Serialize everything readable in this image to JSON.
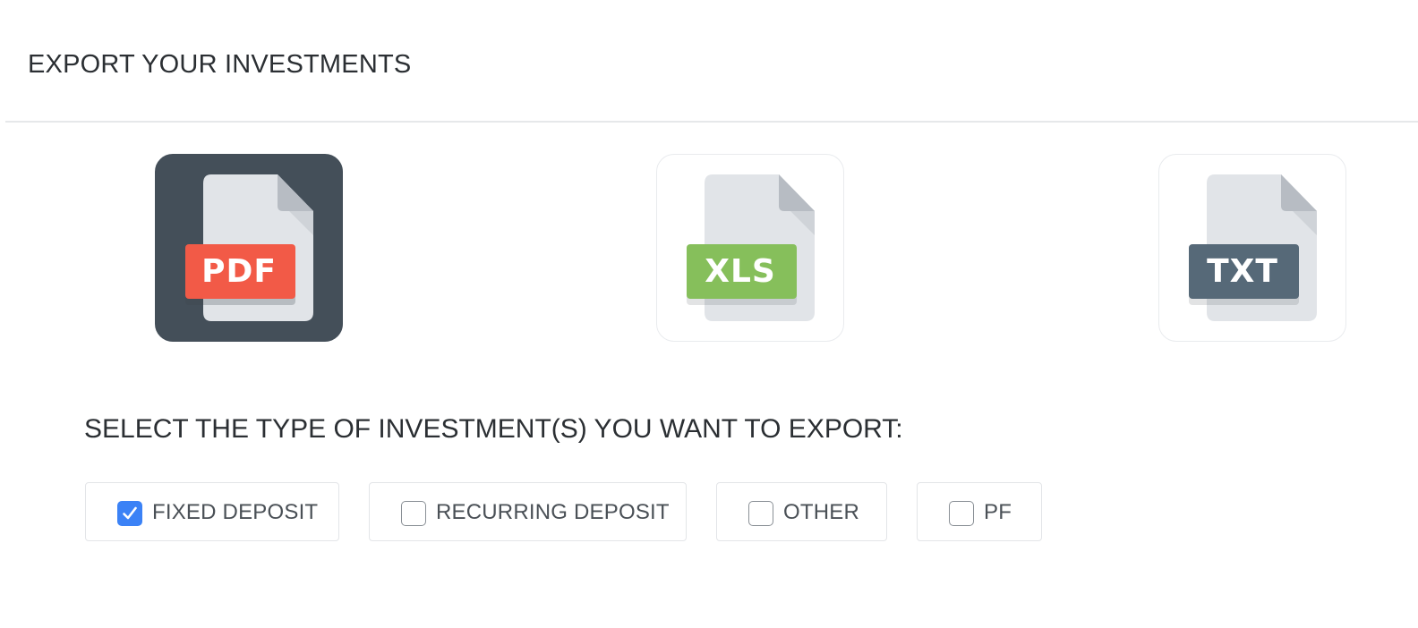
{
  "header": {
    "title": "EXPORT YOUR INVESTMENTS"
  },
  "formats": [
    {
      "label": "PDF",
      "selected": true,
      "color": "#f25a47",
      "icon": "pdf-file-icon"
    },
    {
      "label": "XLS",
      "selected": false,
      "color": "#86bf5b",
      "icon": "xls-file-icon"
    },
    {
      "label": "TXT",
      "selected": false,
      "color": "#566978",
      "icon": "txt-file-icon"
    }
  ],
  "investment_types": {
    "heading": "SELECT THE TYPE OF INVESTMENT(S) YOU WANT TO EXPORT:",
    "options": [
      {
        "label": "FIXED DEPOSIT",
        "checked": true
      },
      {
        "label": "RECURRING DEPOSIT",
        "checked": false
      },
      {
        "label": "OTHER",
        "checked": false
      },
      {
        "label": "PF",
        "checked": false
      }
    ]
  },
  "colors": {
    "selected_card": "#444f59",
    "checkbox_checked": "#3b82f6",
    "divider": "#e6e8ea"
  }
}
